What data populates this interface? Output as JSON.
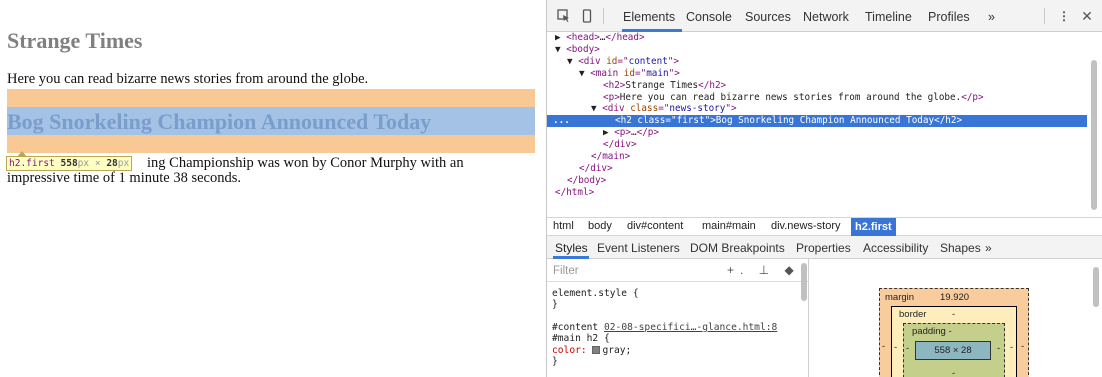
{
  "page": {
    "title": "Strange Times",
    "intro": "Here you can read bizarre news stories from around the globe.",
    "headline": "Bog Snorkeling Champion Announced Today",
    "story_visible": "ing Championship was won by Conor Murphy with an impressive time of 1 minute 38 seconds.",
    "tooltip": {
      "tag": "h2.first",
      "width": "558",
      "height": "28",
      "unit": "px",
      "times": "×"
    }
  },
  "devtools": {
    "tabs": [
      "Elements",
      "Console",
      "Sources",
      "Network",
      "Timeline",
      "Profiles",
      "»"
    ],
    "active_tab": "Elements",
    "dom_lines": [
      {
        "indent": 0,
        "html": "▶ <span class='t'>&lt;head&gt;</span>…<span class='t'>&lt;/head&gt;</span>"
      },
      {
        "indent": 0,
        "html": "▼ <span class='t'>&lt;body&gt;</span>"
      },
      {
        "indent": 1,
        "html": "▼ <span class='t'>&lt;div </span><span class='a'>id</span><span class='t'>=\"</span><span class='v'>content</span><span class='t'>\"&gt;</span>"
      },
      {
        "indent": 2,
        "html": "▼ <span class='t'>&lt;main </span><span class='a'>id</span><span class='t'>=\"</span><span class='v'>main</span><span class='t'>\"&gt;</span>"
      },
      {
        "indent": 4,
        "html": "<span class='t'>&lt;h2&gt;</span>Strange Times<span class='t'>&lt;/h2&gt;</span>"
      },
      {
        "indent": 4,
        "html": "<span class='t'>&lt;p&gt;</span>Here you can read bizarre news stories from around the globe.<span class='t'>&lt;/p&gt;</span>"
      },
      {
        "indent": 3,
        "html": "▼ <span class='t'>&lt;div </span><span class='a'>class</span><span class='t'>=\"</span><span class='v'>news-story</span><span class='t'>\"&gt;</span>"
      },
      {
        "indent": 5,
        "html": "<span class='t'>&lt;h2 </span><span class='a'>class</span><span class='t'>=\"</span><span class='v'>first</span><span class='t'>\"&gt;</span>Bog Snorkeling Champion Announced Today<span class='t'>&lt;/h2&gt;</span>",
        "selected": true
      },
      {
        "indent": 4,
        "html": "▶ <span class='t'>&lt;p&gt;</span>…<span class='t'>&lt;/p&gt;</span>"
      },
      {
        "indent": 4,
        "html": "<span class='t'>&lt;/div&gt;</span>"
      },
      {
        "indent": 3,
        "html": "<span class='t'>&lt;/main&gt;</span>"
      },
      {
        "indent": 2,
        "html": "<span class='t'>&lt;/div&gt;</span>"
      },
      {
        "indent": 1,
        "html": "<span class='t'>&lt;/body&gt;</span>"
      },
      {
        "indent": 0,
        "html": "<span class='t'>&lt;/html&gt;</span>"
      }
    ],
    "selected_marker": "...",
    "breadcrumbs": [
      "html",
      "body",
      "div#content",
      "main#main",
      "div.news-story",
      "h2.first"
    ],
    "subtabs": [
      "Styles",
      "Event Listeners",
      "DOM Breakpoints",
      "Properties",
      "Accessibility",
      "Shapes",
      "»"
    ],
    "active_subtab": "Styles",
    "filter_placeholder": "Filter",
    "filter_tools": "+. ⊥ ◆",
    "css_rules": [
      "element.style {",
      "}",
      "",
      "#content",
      "#main h2 {",
      "  color:",
      "}"
    ],
    "css_link": "02-08-specifici…-glance.html:8",
    "css_value": "gray;",
    "box_model": {
      "margin_label": "margin",
      "margin_value": "19.920",
      "border_label": "border",
      "border_value": "-",
      "padding_label": "padding -",
      "content": "558 × 28",
      "dash": "-"
    }
  }
}
